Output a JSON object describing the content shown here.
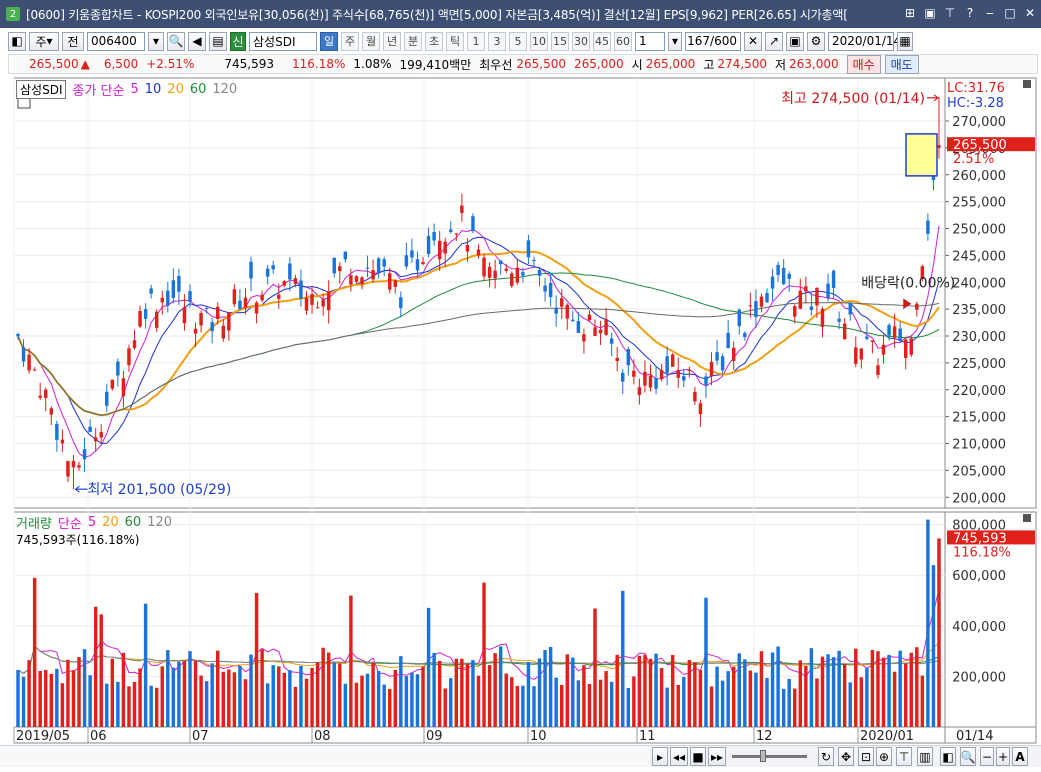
{
  "window": {
    "icon_label": "2",
    "title": "[0600] 키움종합차트 - KOSPI200 외국인보유[30,056(천)] 주식수[68,765(천)] 액면[5,000] 자본금[3,485(억)] 결산[12월] EPS[9,962] PER[26.65] 시가총액[",
    "controls": [
      "⊞",
      "▣",
      "⊤",
      "?",
      "‒",
      "□",
      "✕"
    ]
  },
  "toolbar": {
    "mode_label": "주",
    "prev_label": "전",
    "code": "006400",
    "market_badge": "신",
    "stock_name": "삼성SDI",
    "periods": [
      "일",
      "주",
      "월",
      "년",
      "분",
      "초",
      "틱"
    ],
    "active_period": "일",
    "numbers": [
      "1",
      "3",
      "5",
      "10",
      "15",
      "30",
      "45",
      "60"
    ],
    "unit_value": "1",
    "count": "167",
    "count_max": "/600",
    "date": "2020/01/14"
  },
  "quote": {
    "price": "265,500",
    "arrow": "▲",
    "change": "6,500",
    "change_pct": "+2.51%",
    "volume": "745,593",
    "volume_ratio": "116.18%",
    "turnover": "1.08%",
    "amount": "199,410백만",
    "best_label": "최우선",
    "best_ask": "265,500",
    "best_bid": "265,000",
    "open_label": "시",
    "open": "265,000",
    "high_label": "고",
    "high": "274,500",
    "low_label": "저",
    "low": "263,000",
    "buy_label": "매수",
    "sell_label": "매도"
  },
  "price_panel": {
    "legend_name": "삼성SDI",
    "legend_ma_label": "종가 단순",
    "ma_periods": [
      "5",
      "10",
      "20",
      "60",
      "120"
    ],
    "ma_colors": [
      "#d21ed2",
      "#1b2fd6",
      "#f0a010",
      "#1e8c3a",
      "#6a6a6a"
    ],
    "lc_label": "LC:31.76",
    "hc_label": "HC:-3.28",
    "high_annotation": "최고 274,500 (01/14)",
    "low_annotation": "최저 201,500 (05/29)",
    "dividend_annotation": "배당락(0.00%)",
    "price_tag": "265,500",
    "price_tag_pct": "2.51%",
    "y_ticks": [
      "270,000",
      "265,000",
      "260,000",
      "255,000",
      "250,000",
      "245,000",
      "240,000",
      "235,000",
      "230,000",
      "225,000",
      "220,000",
      "215,000",
      "210,000",
      "205,000",
      "200,000"
    ]
  },
  "volume_panel": {
    "legend_label": "거래량",
    "legend_ma_label": "단순",
    "ma_periods": [
      "5",
      "20",
      "60",
      "120"
    ],
    "value_text": "745,593주(116.18%)",
    "tag_value": "745,593",
    "tag_pct": "116.18%",
    "y_ticks": [
      "800,000",
      "600,000",
      "400,000",
      "200,000"
    ]
  },
  "x_axis": {
    "labels": [
      "2019/05",
      "06",
      "07",
      "08",
      "09",
      "10",
      "11",
      "12",
      "2020/01"
    ],
    "cursor_label": "01/14"
  },
  "colors": {
    "up": "#e0201b",
    "down": "#1a73d9",
    "title_bg": "#3d4f73"
  },
  "chart_data": {
    "type": "candlestick",
    "period": "daily",
    "x_range": [
      "2019/05/14",
      "2020/01/14"
    ],
    "price_ylim": [
      198000,
      278000
    ],
    "volume_ylim": [
      0,
      850000
    ],
    "key_points": [
      {
        "label": "최고",
        "value": 274500,
        "date": "01/14"
      },
      {
        "label": "최저",
        "value": 201500,
        "date": "05/29"
      }
    ],
    "last": {
      "open": 265000,
      "high": 274500,
      "low": 263000,
      "close": 265500,
      "volume": 745593
    }
  }
}
